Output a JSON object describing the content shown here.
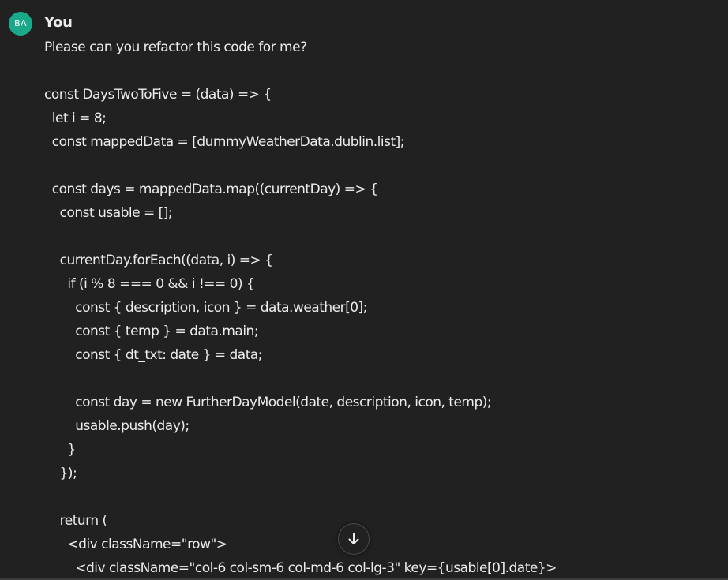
{
  "message": {
    "avatar_initials": "BA",
    "avatar_color": "#19a889",
    "author": "You",
    "text": "Please can you refactor this code for me?\n\nconst DaysTwoToFive = (data) => {\n  let i = 8;\n  const mappedData = [dummyWeatherData.dublin.list];\n\n  const days = mappedData.map((currentDay) => {\n    const usable = [];\n\n    currentDay.forEach((data, i) => {\n      if (i % 8 === 0 && i !== 0) {\n        const { description, icon } = data.weather[0];\n        const { temp } = data.main;\n        const { dt_txt: date } = data;\n\n        const day = new FurtherDayModel(date, description, icon, temp);\n        usable.push(day);\n      }\n    });\n\n    return (\n      <div className=\"row\">\n        <div className=\"col-6 col-sm-6 col-md-6 col-lg-3\" key={usable[0].date}>"
  },
  "scroll_button": {
    "icon": "arrow-down-icon"
  },
  "colors": {
    "background": "#212121",
    "text": "#ececec"
  }
}
